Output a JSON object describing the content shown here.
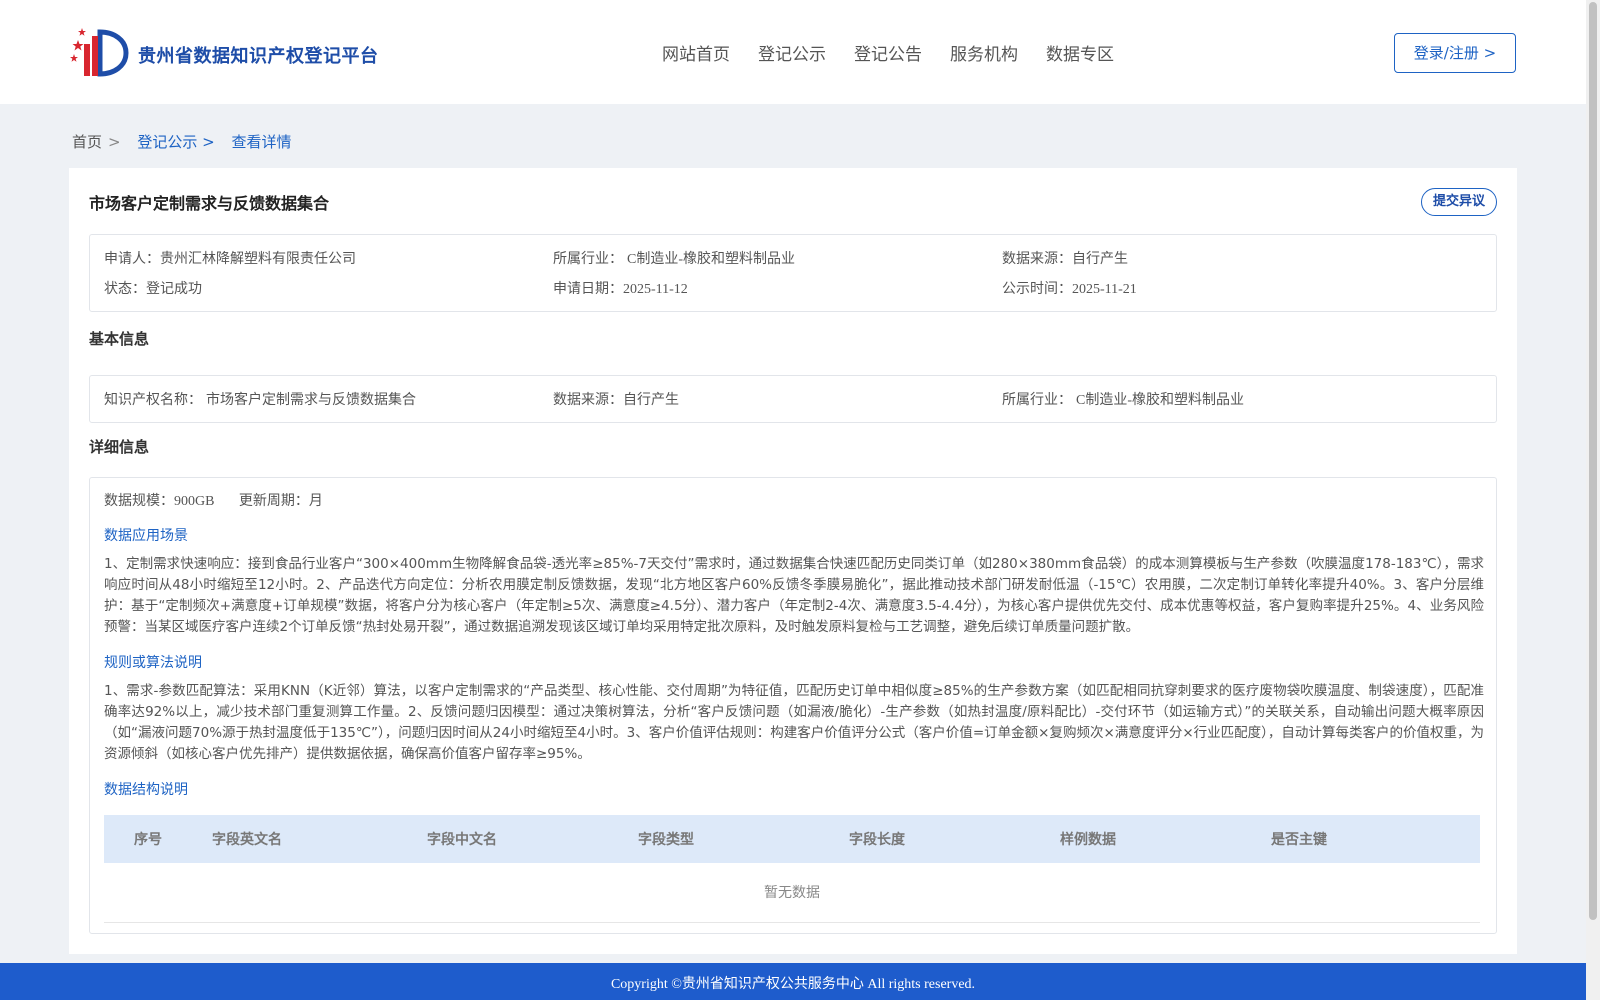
{
  "header": {
    "site_title": "贵州省数据知识产权登记平台",
    "nav": [
      "网站首页",
      "登记公示",
      "登记公告",
      "服务机构",
      "数据专区"
    ],
    "login_label": "登录/注册 >"
  },
  "breadcrumb": {
    "home": "首页",
    "sep": ">",
    "section": "登记公示 >",
    "current": "查看详情"
  },
  "detail": {
    "title": "市场客户定制需求与反馈数据集合",
    "dispute_label": "提交异议",
    "summary": {
      "applicant_label": "申请人：",
      "applicant": "贵州汇林降解塑料有限责任公司",
      "industry_label": "所属行业：",
      "industry": "C制造业-橡胶和塑料制品业",
      "source_label": "数据来源：",
      "source": "自行产生",
      "status_label": "状态：",
      "status": "登记成功",
      "apply_date_label": "申请日期：",
      "apply_date": "2025-11-12",
      "publish_date_label": "公示时间：",
      "publish_date": "2025-11-21"
    },
    "basic": {
      "section_title": "基本信息",
      "ip_name_label": "知识产权名称：",
      "ip_name": "市场客户定制需求与反馈数据集合",
      "source_label": "数据来源：",
      "source": "自行产生",
      "industry_label": "所属行业：",
      "industry": "C制造业-橡胶和塑料制品业"
    },
    "more": {
      "section_title": "详细信息",
      "scale_label": "数据规模：",
      "scale": "900GB",
      "cycle_label": "更新周期：",
      "cycle": "月",
      "scenario_title": "数据应用场景",
      "scenario_text": "1、定制需求快速响应：接到食品行业客户“300×400mm生物降解食品袋-透光率≥85%-7天交付”需求时，通过数据集合快速匹配历史同类订单（如280×380mm食品袋）的成本测算模板与生产参数（吹膜温度178-183℃），需求响应时间从48小时缩短至12小时。2、产品迭代方向定位：分析农用膜定制反馈数据，发现“北方地区客户60%反馈冬季膜易脆化”，据此推动技术部门研发耐低温（-15℃）农用膜，二次定制订单转化率提升40%。3、客户分层维护：基于“定制频次+满意度+订单规模”数据，将客户分为核心客户（年定制≥5次、满意度≥4.5分）、潜力客户（年定制2-4次、满意度3.5-4.4分），为核心客户提供优先交付、成本优惠等权益，客户复购率提升25%。4、业务风险预警：当某区域医疗客户连续2个订单反馈“热封处易开裂”，通过数据追溯发现该区域订单均采用特定批次原料，及时触发原料复检与工艺调整，避免后续订单质量问题扩散。",
      "rule_title": "规则或算法说明",
      "rule_text": "1、需求-参数匹配算法：采用KNN（K近邻）算法，以客户定制需求的“产品类型、核心性能、交付周期”为特征值，匹配历史订单中相似度≥85%的生产参数方案（如匹配相同抗穿刺要求的医疗废物袋吹膜温度、制袋速度），匹配准确率达92%以上，减少技术部门重复测算工作量。2、反馈问题归因模型：通过决策树算法，分析“客户反馈问题（如漏液/脆化）-生产参数（如热封温度/原料配比）-交付环节（如运输方式）”的关联关系，自动输出问题大概率原因（如“漏液问题70%源于热封温度低于135℃”），问题归因时间从24小时缩短至4小时。3、客户价值评估规则：构建客户价值评分公式（客户价值=订单金额×复购频次×满意度评分×行业匹配度），自动计算每类客户的价值权重，为资源倾斜（如核心客户优先排产）提供数据依据，确保高价值客户留存率≥95%。",
      "structure_title": "数据结构说明",
      "table": {
        "columns": [
          "序号",
          "字段英文名",
          "字段中文名",
          "字段类型",
          "字段长度",
          "样例数据",
          "是否主键"
        ],
        "empty_text": "暂无数据"
      }
    }
  },
  "footer": {
    "copyright": "Copyright ©贵州省知识产权公共服务中心 All rights reserved."
  },
  "colors": {
    "brand": "#1e63c4",
    "footer_bg": "#1e5ccc",
    "table_header_bg": "#dde9f9"
  }
}
